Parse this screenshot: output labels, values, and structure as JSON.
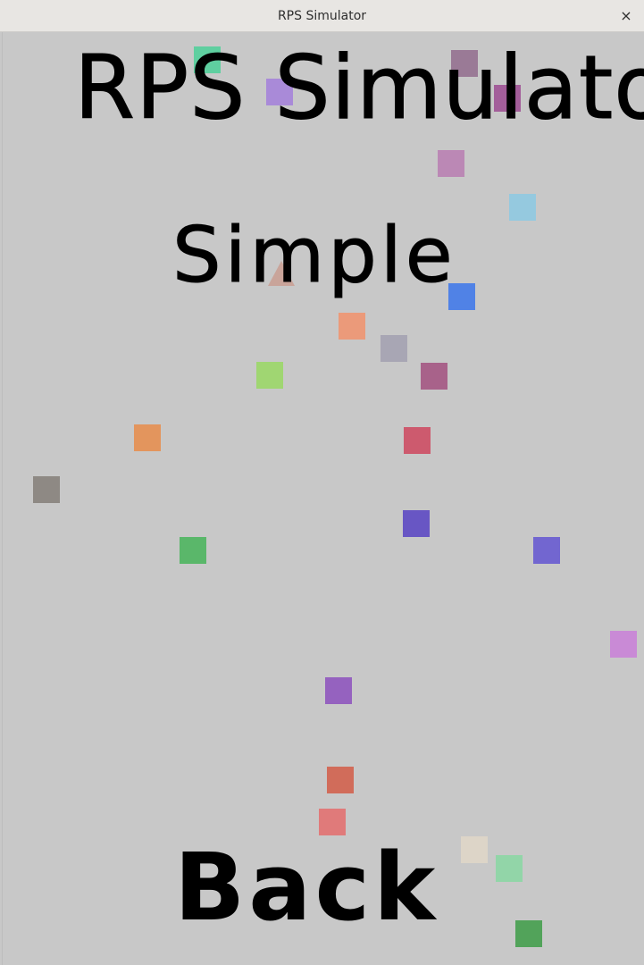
{
  "window": {
    "title": "RPS Simulator",
    "close_glyph": "×"
  },
  "canvas": {
    "background": "#c8c8c8",
    "title": "RPS Simulator",
    "mode_label": "Simple",
    "back_label": "Back"
  },
  "sprites": [
    {
      "shape": "square",
      "color": "#5fcfa0"
    },
    {
      "shape": "square",
      "color": "#a98ad8"
    },
    {
      "shape": "square",
      "color": "#9a7a96"
    },
    {
      "shape": "square",
      "color": "#a35e9a"
    },
    {
      "shape": "square",
      "color": "#bb88b5"
    },
    {
      "shape": "square",
      "color": "#95c9df"
    },
    {
      "shape": "triangle",
      "color": "#c9a49a"
    },
    {
      "shape": "square",
      "color": "#5082e6"
    },
    {
      "shape": "square",
      "color": "#eb9a7a"
    },
    {
      "shape": "square",
      "color": "#a8a6b4"
    },
    {
      "shape": "square",
      "color": "#a0d672"
    },
    {
      "shape": "square",
      "color": "#a8628a"
    },
    {
      "shape": "square",
      "color": "#e3955d"
    },
    {
      "shape": "square",
      "color": "#cd5a6e"
    },
    {
      "shape": "square",
      "color": "#8e8984"
    },
    {
      "shape": "square",
      "color": "#6856c4"
    },
    {
      "shape": "square",
      "color": "#5ab76a"
    },
    {
      "shape": "square",
      "color": "#7266d0"
    },
    {
      "shape": "square",
      "color": "#c98ad6"
    },
    {
      "shape": "square",
      "color": "#9562bf"
    },
    {
      "shape": "square",
      "color": "#d16c5a"
    },
    {
      "shape": "square",
      "color": "#e07a7a"
    },
    {
      "shape": "square",
      "color": "#ddd5c8"
    },
    {
      "shape": "square",
      "color": "#92d5a8"
    },
    {
      "shape": "square",
      "color": "#52a35a"
    }
  ]
}
